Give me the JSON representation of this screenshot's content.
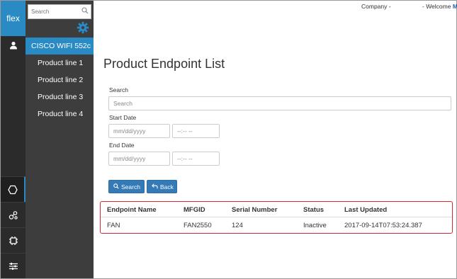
{
  "rail": {
    "logo": "flex",
    "icons": [
      "user-icon",
      "hexagon-icon",
      "nodes-icon",
      "chip-icon",
      "sliders-icon"
    ]
  },
  "nav": {
    "search_placeholder": "Search",
    "active_item": "CISCO WIFI 552c",
    "items": [
      {
        "label": "Product line 1"
      },
      {
        "label": "Product line 2"
      },
      {
        "label": "Product line 3"
      },
      {
        "label": "Product line 4"
      }
    ]
  },
  "topbar": {
    "company_label": "Company -",
    "welcome_label": "- Welcome",
    "welcome_user": "M"
  },
  "page": {
    "title": "Product Endpoint List"
  },
  "form": {
    "search_label": "Search",
    "search_placeholder": "Search",
    "start_date_label": "Start Date",
    "end_date_label": "End Date",
    "date_placeholder": "mm/dd/yyyy",
    "time_placeholder": "--:-- --",
    "search_button": "Search",
    "back_button": "Back"
  },
  "table": {
    "headers": [
      "Endpoint Name",
      "MFGID",
      "Serial Number",
      "Status",
      "Last Updated"
    ],
    "rows": [
      [
        "FAN",
        "FAN2550",
        "124",
        "Inactive",
        "2017-09-14T07:53:24.387"
      ]
    ]
  },
  "colors": {
    "accent": "#2a8ac4",
    "button": "#337ab7",
    "highlight_border": "#d9262e"
  }
}
